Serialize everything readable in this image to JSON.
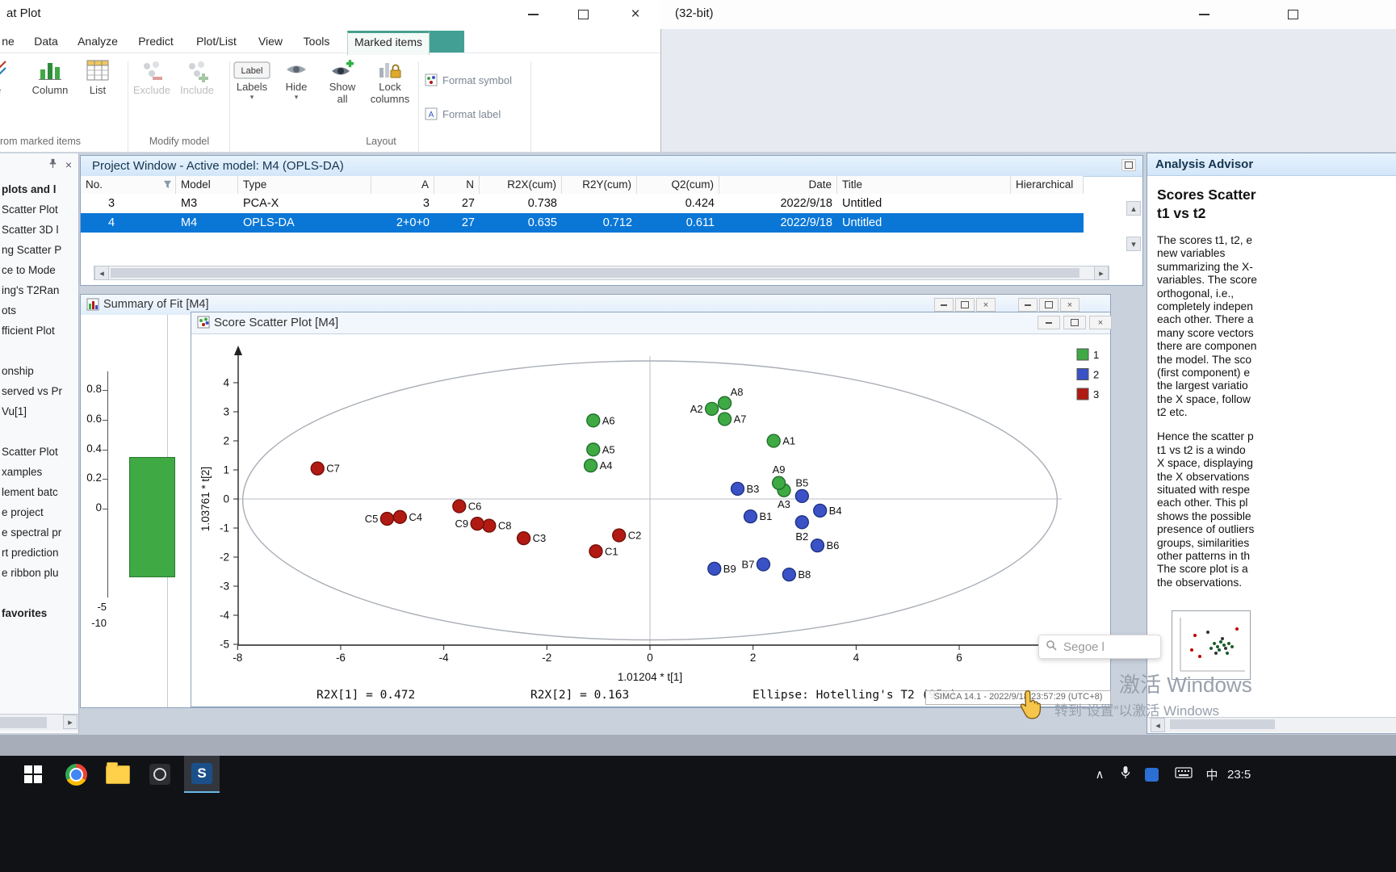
{
  "titlebar": {
    "title": "at Plot"
  },
  "background_window": {
    "title_fragment": "(32-bit)"
  },
  "ribbon": {
    "tabs": [
      {
        "label": "ne",
        "active": false
      },
      {
        "label": "Data",
        "active": false
      },
      {
        "label": "Analyze",
        "active": false
      },
      {
        "label": "Predict",
        "active": false
      },
      {
        "label": "Plot/List",
        "active": false
      },
      {
        "label": "View",
        "active": false
      },
      {
        "label": "Tools",
        "active": false
      },
      {
        "label": "Marked items",
        "active": true
      }
    ],
    "buttons": {
      "line": "ne",
      "column": "Column",
      "list": "List",
      "exclude": "Exclude",
      "include": "Include",
      "labels": "Labels",
      "hide": "Hide",
      "show_all": "Show all",
      "lock_columns": "Lock columns",
      "format_symbol": "Format symbol",
      "format_label": "Format label"
    },
    "groups": [
      "rom marked items",
      "Modify model",
      "Layout"
    ]
  },
  "project_window": {
    "title": "Project Window - Active model: M4 (OPLS-DA)",
    "columns": [
      "No.",
      "Model",
      "Type",
      "A",
      "N",
      "R2X(cum)",
      "R2Y(cum)",
      "Q2(cum)",
      "Date",
      "Title",
      "Hierarchical"
    ],
    "rows": [
      {
        "cells": [
          "3",
          "M3",
          "PCA-X",
          "3",
          "27",
          "0.738",
          "",
          "0.424",
          "2022/9/18",
          "Untitled",
          ""
        ],
        "selected": false
      },
      {
        "cells": [
          "4",
          "M4",
          "OPLS-DA",
          "2+0+0",
          "27",
          "0.635",
          "0.712",
          "0.611",
          "2022/9/18",
          "Untitled",
          ""
        ],
        "selected": true
      }
    ]
  },
  "summary_window": {
    "title": "Summary of Fit [M4]"
  },
  "score_window": {
    "title": "Score Scatter Plot [M4]",
    "status_tooltip": "SIMCA 14.1 - 2022/9/18 23:57:29 (UTC+8)"
  },
  "sidebar": {
    "items": [
      {
        "text": "plots and l",
        "bold": true
      },
      {
        "text": "Scatter Plot"
      },
      {
        "text": "Scatter 3D l"
      },
      {
        "text": "ng Scatter P"
      },
      {
        "text": "ce to Mode"
      },
      {
        "text": "ing's T2Ran"
      },
      {
        "text": "ots"
      },
      {
        "text": "fficient Plot"
      },
      {
        "spacer": true
      },
      {
        "text": "onship"
      },
      {
        "text": "served vs Pr"
      },
      {
        "text": "Vu[1]"
      },
      {
        "spacer": true
      },
      {
        "text": "Scatter Plot"
      },
      {
        "text": "xamples"
      },
      {
        "text": "lement batc"
      },
      {
        "text": "e project"
      },
      {
        "text": "e spectral pr"
      },
      {
        "text": "rt prediction"
      },
      {
        "text": "e ribbon plu"
      },
      {
        "spacer": true
      },
      {
        "text": "favorites",
        "bold": true
      }
    ]
  },
  "advisor": {
    "title": "Analysis Advisor",
    "heading_line1": "Scores Scatter",
    "heading_line2": "t1 vs t2",
    "paragraph1": [
      "The scores t1, t2, e",
      "new variables",
      "summarizing the X-",
      "variables. The score",
      "orthogonal, i.e.,",
      "completely indepen",
      "each other. There a",
      "many score vectors",
      "there are componen",
      "the model. The sco",
      "(first component) e",
      "the largest variatio",
      "the X space, follow",
      "t2 etc."
    ],
    "paragraph2": [
      "Hence the scatter p",
      "t1 vs t2 is a windo",
      "X space, displaying",
      "the X observations",
      "situated with respe",
      "each other. This pl",
      "shows the possible",
      "presence of outliers",
      "groups, similarities",
      "other patterns in th",
      "The score plot is a",
      "the observations."
    ]
  },
  "overlays": {
    "watermark_line1": "激活 Windows",
    "watermark_line2": "转到“设置”以激活 Windows",
    "floating_pill_text": "Segoe l"
  },
  "taskbar": {
    "clock": "23:5",
    "ime_badge": "中"
  },
  "chart_data": [
    {
      "type": "scatter",
      "title": "Score Scatter Plot [M4]",
      "xlabel": "1.01204 * t[1]",
      "ylabel": "1.03761 * t[2]",
      "xlim": [
        -8,
        8
      ],
      "ylim": [
        -5,
        5
      ],
      "x_ticks": [
        -8,
        -6,
        -4,
        -2,
        0,
        2,
        4,
        6
      ],
      "y_ticks": [
        4,
        3,
        2,
        1,
        0,
        -1,
        -2,
        -3,
        -4,
        -5
      ],
      "grid": false,
      "legend_position": "right-top",
      "ellipse": {
        "cx": 0,
        "cy": -0.05,
        "rx": 7.9,
        "ry": 4.8
      },
      "legend": [
        {
          "label": "1",
          "color": "#3fa944"
        },
        {
          "label": "2",
          "color": "#3a52c6"
        },
        {
          "label": "3",
          "color": "#b11a12"
        }
      ],
      "annotations": {
        "r2x1": "R2X[1] = 0.472",
        "r2x2": "R2X[2] = 0.163",
        "ellipse": "Ellipse: Hotelling's T2 (95%)"
      },
      "series": [
        {
          "name": "1",
          "color": "#3fa944",
          "stroke": "#1f6b28",
          "points": [
            {
              "id": "A1",
              "x": 2.4,
              "y": 2.0,
              "pos": "r"
            },
            {
              "id": "A2",
              "x": 1.2,
              "y": 3.1,
              "pos": "l"
            },
            {
              "id": "A3",
              "x": 2.6,
              "y": 0.3,
              "pos": "b"
            },
            {
              "id": "A4",
              "x": -1.15,
              "y": 1.15,
              "pos": "r"
            },
            {
              "id": "A5",
              "x": -1.1,
              "y": 1.7,
              "pos": "r"
            },
            {
              "id": "A6",
              "x": -1.1,
              "y": 2.7,
              "pos": "r"
            },
            {
              "id": "A7",
              "x": 1.45,
              "y": 2.75,
              "pos": "r"
            },
            {
              "id": "A8",
              "x": 1.45,
              "y": 3.3,
              "pos": "ra"
            },
            {
              "id": "A9",
              "x": 2.5,
              "y": 0.55,
              "pos": "a"
            }
          ]
        },
        {
          "name": "2",
          "color": "#3a52c6",
          "stroke": "#1d2f7e",
          "points": [
            {
              "id": "B1",
              "x": 1.95,
              "y": -0.6,
              "pos": "r"
            },
            {
              "id": "B2",
              "x": 2.95,
              "y": -0.8,
              "pos": "b"
            },
            {
              "id": "B3",
              "x": 1.7,
              "y": 0.35,
              "pos": "r"
            },
            {
              "id": "B4",
              "x": 3.3,
              "y": -0.4,
              "pos": "r"
            },
            {
              "id": "B5",
              "x": 2.95,
              "y": 0.1,
              "pos": "a"
            },
            {
              "id": "B6",
              "x": 3.25,
              "y": -1.6,
              "pos": "r"
            },
            {
              "id": "B7",
              "x": 2.2,
              "y": -2.25,
              "pos": "l"
            },
            {
              "id": "B8",
              "x": 2.7,
              "y": -2.6,
              "pos": "r"
            },
            {
              "id": "B9",
              "x": 1.25,
              "y": -2.4,
              "pos": "r"
            }
          ]
        },
        {
          "name": "3",
          "color": "#b11a12",
          "stroke": "#6e0d09",
          "points": [
            {
              "id": "C1",
              "x": -1.05,
              "y": -1.8,
              "pos": "r"
            },
            {
              "id": "C2",
              "x": -0.6,
              "y": -1.25,
              "pos": "r"
            },
            {
              "id": "C3",
              "x": -2.45,
              "y": -1.35,
              "pos": "r"
            },
            {
              "id": "C4",
              "x": -4.85,
              "y": -0.62,
              "pos": "r"
            },
            {
              "id": "C5",
              "x": -5.1,
              "y": -0.68,
              "pos": "l"
            },
            {
              "id": "C6",
              "x": -3.7,
              "y": -0.25,
              "pos": "r"
            },
            {
              "id": "C7",
              "x": -6.45,
              "y": 1.05,
              "pos": "r"
            },
            {
              "id": "C8",
              "x": -3.12,
              "y": -0.92,
              "pos": "r"
            },
            {
              "id": "C9",
              "x": -3.35,
              "y": -0.85,
              "pos": "l"
            }
          ]
        }
      ]
    },
    {
      "type": "bar",
      "title": "Summary of Fit [M4]",
      "y_ticks": [
        "0.8",
        "0.6",
        "0.4",
        "0.2",
        "0"
      ],
      "values": [
        0.35
      ],
      "bar_color": "#3fa944",
      "extra_tick_labels": [
        "-5",
        "-10"
      ]
    }
  ]
}
